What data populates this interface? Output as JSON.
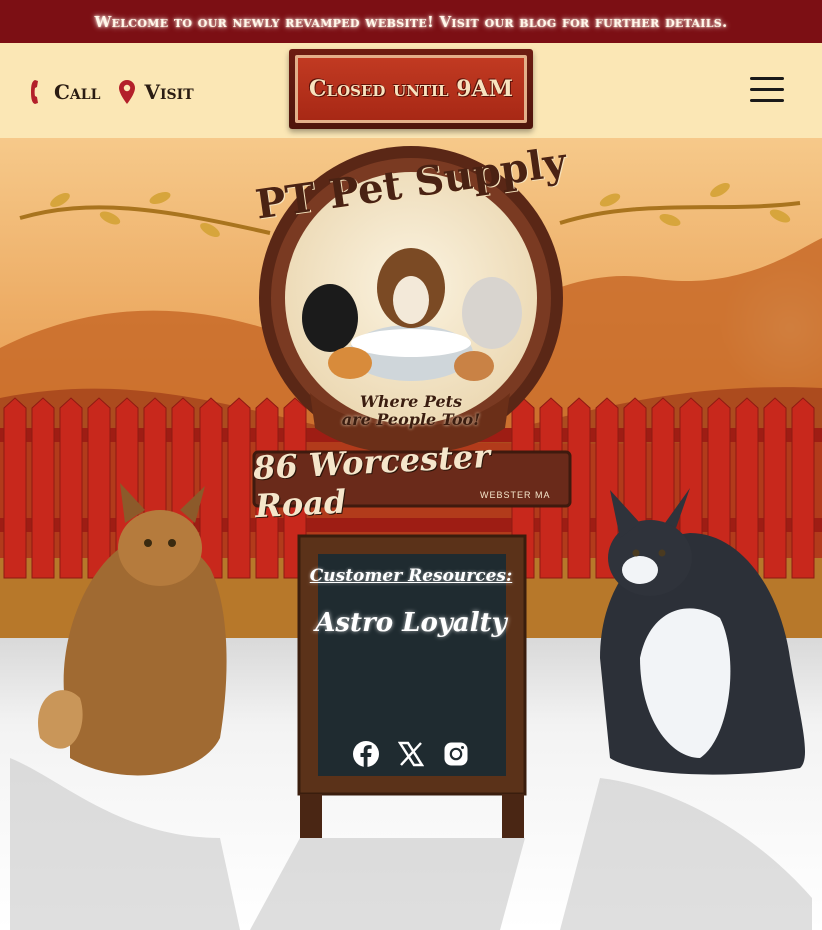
{
  "banner": {
    "text": "Welcome to our newly revamped website! Visit our blog for further details."
  },
  "header": {
    "call_label": "Call",
    "visit_label": "Visit",
    "status": "Closed until 9AM"
  },
  "hero": {
    "brand_name": "PT Pet Supply",
    "tagline_line1": "Where Pets",
    "tagline_line2": "are People Too!",
    "address": "86 Worcester Road",
    "city": "WEBSTER MA",
    "board_heading": "Customer Resources:",
    "board_link": "Astro Loyalty"
  },
  "socials": [
    {
      "name": "facebook-icon"
    },
    {
      "name": "x-icon"
    },
    {
      "name": "instagram-icon"
    }
  ],
  "colors": {
    "banner_bg": "#7c0f14",
    "header_bg": "#fbe7b5",
    "sign_red": "#b02c17",
    "fence_red": "#c8281c",
    "chalkboard": "#1f2b30"
  }
}
